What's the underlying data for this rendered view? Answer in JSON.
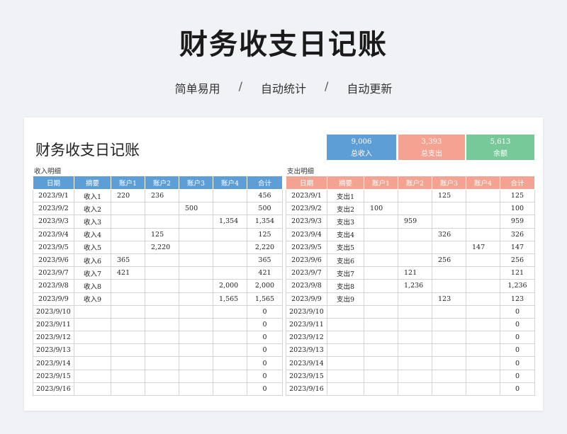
{
  "page_title": "财务收支日记账",
  "subtitle": {
    "items": [
      "简单易用",
      "自动统计",
      "自动更新"
    ],
    "separator": "/"
  },
  "sheet": {
    "title": "财务收支日记账",
    "summary": {
      "income": {
        "value": "9,006",
        "label": "总收入",
        "color": "#5e9ed6"
      },
      "expense": {
        "value": "3,393",
        "label": "总支出",
        "color": "#f4a393"
      },
      "balance": {
        "value": "5,613",
        "label": "余额",
        "color": "#77c99a"
      }
    },
    "income_section": {
      "label": "收入明细",
      "headers": [
        "日期",
        "摘要",
        "账户1",
        "账户2",
        "账户3",
        "账户4",
        "合计"
      ],
      "rows": [
        [
          "2023/9/1",
          "收入1",
          "220",
          "236",
          "",
          "",
          "456"
        ],
        [
          "2023/9/2",
          "收入2",
          "",
          "",
          "500",
          "",
          "500"
        ],
        [
          "2023/9/3",
          "收入3",
          "",
          "",
          "",
          "1,354",
          "1,354"
        ],
        [
          "2023/9/4",
          "收入4",
          "",
          "125",
          "",
          "",
          "125"
        ],
        [
          "2023/9/5",
          "收入5",
          "",
          "2,220",
          "",
          "",
          "2,220"
        ],
        [
          "2023/9/6",
          "收入6",
          "365",
          "",
          "",
          "",
          "365"
        ],
        [
          "2023/9/7",
          "收入7",
          "421",
          "",
          "",
          "",
          "421"
        ],
        [
          "2023/9/8",
          "收入8",
          "",
          "",
          "",
          "2,000",
          "2,000"
        ],
        [
          "2023/9/9",
          "收入9",
          "",
          "",
          "",
          "1,565",
          "1,565"
        ],
        [
          "2023/9/10",
          "",
          "",
          "",
          "",
          "",
          "0"
        ],
        [
          "2023/9/11",
          "",
          "",
          "",
          "",
          "",
          "0"
        ],
        [
          "2023/9/12",
          "",
          "",
          "",
          "",
          "",
          "0"
        ],
        [
          "2023/9/13",
          "",
          "",
          "",
          "",
          "",
          "0"
        ],
        [
          "2023/9/14",
          "",
          "",
          "",
          "",
          "",
          "0"
        ],
        [
          "2023/9/15",
          "",
          "",
          "",
          "",
          "",
          "0"
        ],
        [
          "2023/9/16",
          "",
          "",
          "",
          "",
          "",
          "0"
        ]
      ]
    },
    "expense_section": {
      "label": "支出明细",
      "headers": [
        "日期",
        "摘要",
        "账户1",
        "账户2",
        "账户3",
        "账户4",
        "合计"
      ],
      "rows": [
        [
          "2023/9/1",
          "支出1",
          "",
          "",
          "125",
          "",
          "125"
        ],
        [
          "2023/9/2",
          "支出2",
          "100",
          "",
          "",
          "",
          "100"
        ],
        [
          "2023/9/3",
          "支出3",
          "",
          "959",
          "",
          "",
          "959"
        ],
        [
          "2023/9/4",
          "支出4",
          "",
          "",
          "326",
          "",
          "326"
        ],
        [
          "2023/9/5",
          "支出5",
          "",
          "",
          "",
          "147",
          "147"
        ],
        [
          "2023/9/6",
          "支出6",
          "",
          "",
          "256",
          "",
          "256"
        ],
        [
          "2023/9/7",
          "支出7",
          "",
          "121",
          "",
          "",
          "121"
        ],
        [
          "2023/9/8",
          "支出8",
          "",
          "1,236",
          "",
          "",
          "1,236"
        ],
        [
          "2023/9/9",
          "支出9",
          "",
          "",
          "123",
          "",
          "123"
        ],
        [
          "2023/9/10",
          "",
          "",
          "",
          "",
          "",
          "0"
        ],
        [
          "2023/9/11",
          "",
          "",
          "",
          "",
          "",
          "0"
        ],
        [
          "2023/9/12",
          "",
          "",
          "",
          "",
          "",
          "0"
        ],
        [
          "2023/9/13",
          "",
          "",
          "",
          "",
          "",
          "0"
        ],
        [
          "2023/9/14",
          "",
          "",
          "",
          "",
          "",
          "0"
        ],
        [
          "2023/9/15",
          "",
          "",
          "",
          "",
          "",
          "0"
        ],
        [
          "2023/9/16",
          "",
          "",
          "",
          "",
          "",
          "0"
        ]
      ]
    }
  }
}
